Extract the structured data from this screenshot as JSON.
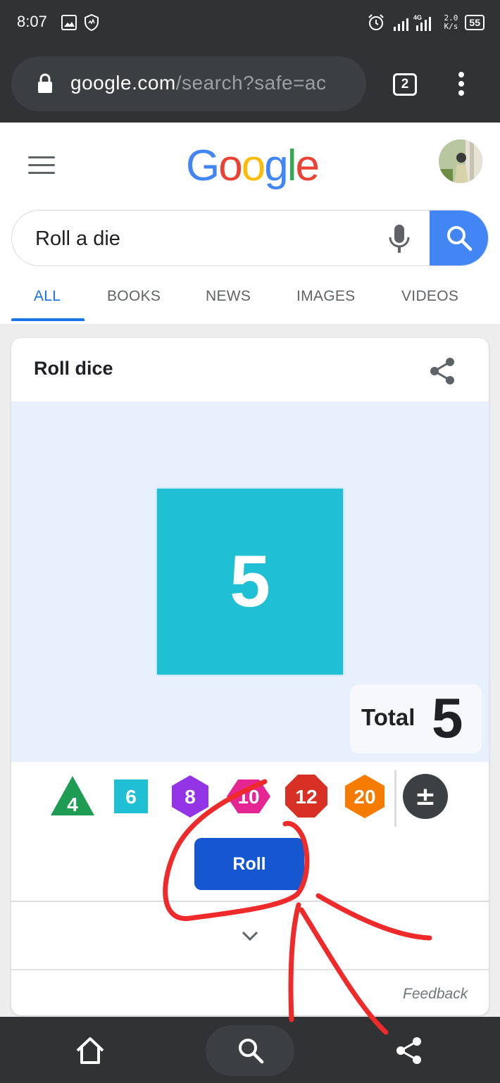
{
  "status_bar": {
    "time": "8:07",
    "network": "4G",
    "speed_value": "2.0",
    "speed_unit": "K/s",
    "battery": "55"
  },
  "browser": {
    "url_domain": "google.com",
    "url_rest": "/search?safe=ac",
    "tab_count": "2"
  },
  "header": {
    "logo_letters": [
      {
        "char": "G",
        "color": "#4285f4"
      },
      {
        "char": "o",
        "color": "#ea4335"
      },
      {
        "char": "o",
        "color": "#fbbc05"
      },
      {
        "char": "g",
        "color": "#4285f4"
      },
      {
        "char": "l",
        "color": "#34a853"
      },
      {
        "char": "e",
        "color": "#ea4335"
      }
    ],
    "search_query": "Roll a die",
    "tabs": [
      "ALL",
      "BOOKS",
      "NEWS",
      "IMAGES",
      "VIDEOS"
    ],
    "active_tab": "ALL"
  },
  "card": {
    "title": "Roll dice",
    "die_value": "5",
    "total_label": "Total",
    "total_value": "5",
    "dice_options": [
      {
        "label": "4",
        "shape": "triangle",
        "color": "#1e9c54"
      },
      {
        "label": "6",
        "shape": "square",
        "color": "#1fbfd4"
      },
      {
        "label": "8",
        "shape": "hexagon",
        "color": "#9334e6"
      },
      {
        "label": "10",
        "shape": "hexagon-wide",
        "color": "#e52592"
      },
      {
        "label": "12",
        "shape": "octagon",
        "color": "#d93025"
      },
      {
        "label": "20",
        "shape": "hexagon",
        "color": "#f57c00"
      },
      {
        "label": "±",
        "shape": "circle",
        "color": "#3c4043"
      }
    ],
    "roll_label": "Roll",
    "feedback": "Feedback"
  },
  "colors": {
    "accent": "#1a73e8",
    "roll_button": "#1457d1",
    "die_face": "#1fbfd4",
    "dice_area_bg": "#e8f0fd",
    "annotation": "#ef2a2a"
  },
  "icons": {
    "status": [
      "image-icon",
      "shield-icon",
      "alarm-icon",
      "signal-icon"
    ],
    "browser": [
      "lock-icon",
      "tabs-icon",
      "more-vert-icon"
    ],
    "header": [
      "menu-icon",
      "avatar",
      "mic-icon",
      "search-icon"
    ],
    "card": [
      "share-icon",
      "chevron-down-icon"
    ],
    "bottom_nav": [
      "home-icon",
      "search-icon",
      "share-icon"
    ]
  }
}
